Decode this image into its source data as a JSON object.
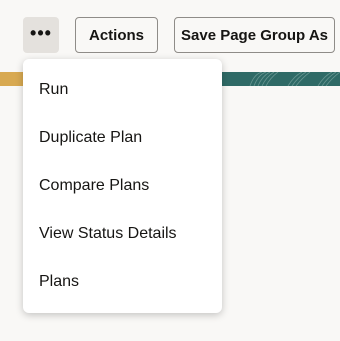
{
  "toolbar": {
    "more_icon": "more-horizontal-icon",
    "more_glyph": "•••",
    "actions_label": "Actions",
    "save_group_label": "Save Page Group As"
  },
  "menu": {
    "items": [
      {
        "label": "Run"
      },
      {
        "label": "Duplicate Plan"
      },
      {
        "label": "Compare Plans"
      },
      {
        "label": "View Status Details"
      },
      {
        "label": "Plans"
      }
    ]
  },
  "colors": {
    "band_gold": "#d8a951",
    "band_teal": "#2f6a66",
    "more_button_bg": "#e4e1dd",
    "page_bg": "#f9f8f6"
  }
}
